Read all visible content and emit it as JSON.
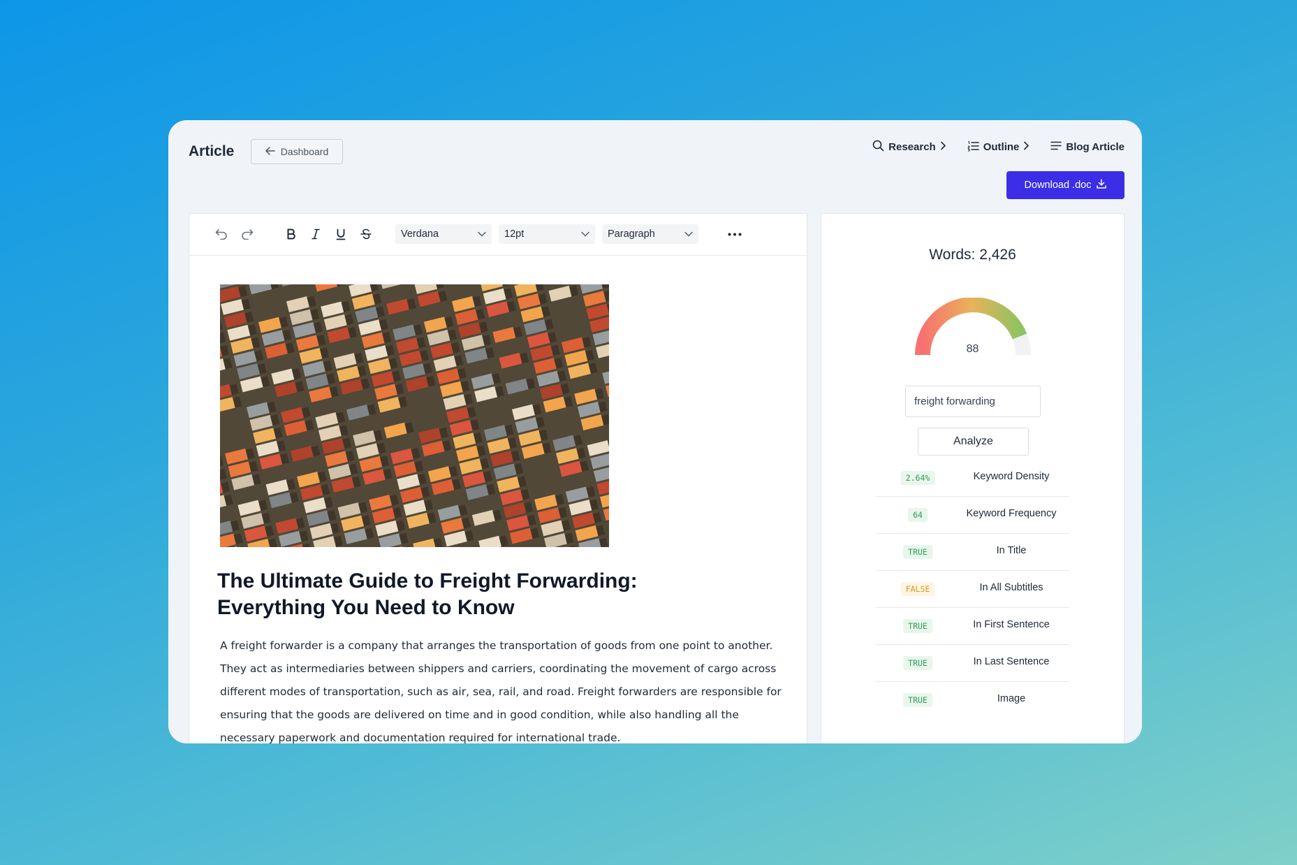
{
  "header": {
    "app_title": "Article",
    "back_label": "Dashboard",
    "steps": [
      {
        "label": "Research",
        "icon": "search-icon"
      },
      {
        "label": "Outline",
        "icon": "list-ordered-icon"
      },
      {
        "label": "Blog Article",
        "icon": "menu-lines-icon"
      }
    ],
    "download_label": "Download .doc"
  },
  "toolbar": {
    "font_family": "Verdana",
    "font_size": "12pt",
    "block_format": "Paragraph"
  },
  "article": {
    "title": "The Ultimate Guide to Freight Forwarding: Everything You Need to Know",
    "body": "A freight forwarder is a company that arranges the transportation of goods from one point to another. They act as intermediaries between shippers and carriers, coordinating the movement of cargo across different modes of transportation, such as air, sea, rail, and road. Freight forwarders are responsible for ensuring that the goods are delivered on time and in good condition, while also handling all the necessary paperwork and documentation required for international trade."
  },
  "analysis": {
    "words": "Words: 2,426",
    "score": "88",
    "score_value": 88,
    "keyword": "freight forwarding",
    "analyze_label": "Analyze",
    "metrics": [
      {
        "badge": "2.64%",
        "label": "Keyword Density",
        "status": "ok"
      },
      {
        "badge": "64",
        "label": "Keyword Frequency",
        "status": "ok"
      },
      {
        "badge": "TRUE",
        "label": "In Title",
        "status": "ok"
      },
      {
        "badge": "FALSE",
        "label": "In All Subtitles",
        "status": "warn"
      },
      {
        "badge": "TRUE",
        "label": "In First Sentence",
        "status": "ok"
      },
      {
        "badge": "TRUE",
        "label": "In Last Sentence",
        "status": "ok"
      },
      {
        "badge": "TRUE",
        "label": "Image",
        "status": "ok"
      }
    ]
  },
  "colors": {
    "accent": "#3b2ee6",
    "ok": "#2f9e54",
    "warn": "#d99a1c"
  }
}
